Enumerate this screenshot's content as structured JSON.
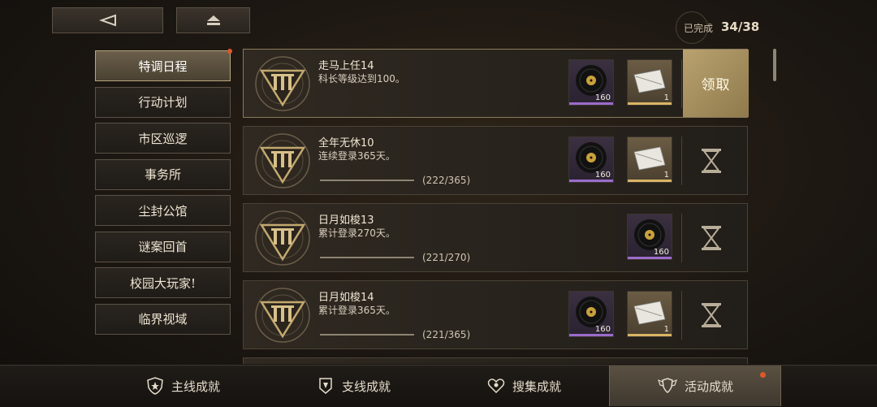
{
  "header": {
    "back_icon": "back-arrow-icon",
    "home_icon": "eject-home-icon",
    "progress_label": "已完成",
    "progress_value": "34/38"
  },
  "sidebar": {
    "items": [
      {
        "label": "特调日程",
        "active": true,
        "has_dot": true
      },
      {
        "label": "行动计划"
      },
      {
        "label": "市区巡逻"
      },
      {
        "label": "事务所"
      },
      {
        "label": "尘封公馆"
      },
      {
        "label": "谜案回首"
      },
      {
        "label": "校园大玩家!"
      },
      {
        "label": "临界视域"
      }
    ]
  },
  "tasks": [
    {
      "title": "走马上任14",
      "desc": "科长等级达到100。",
      "progress": "",
      "rewards": [
        {
          "icon": "vinyl-record-icon",
          "qty": "160"
        },
        {
          "icon": "ticket-envelope-icon",
          "qty": "1"
        }
      ],
      "action": "领取"
    },
    {
      "title": "全年无休10",
      "desc": "连续登录365天。",
      "progress": "(222/365)",
      "rewards": [
        {
          "icon": "vinyl-record-icon",
          "qty": "160"
        },
        {
          "icon": "ticket-envelope-icon",
          "qty": "1"
        }
      ],
      "action": "hourglass-icon"
    },
    {
      "title": "日月如梭13",
      "desc": "累计登录270天。",
      "progress": "(221/270)",
      "rewards": [
        {
          "icon": "vinyl-record-icon",
          "qty": "160"
        }
      ],
      "action": "hourglass-icon"
    },
    {
      "title": "日月如梭14",
      "desc": "累计登录365天。",
      "progress": "(221/365)",
      "rewards": [
        {
          "icon": "vinyl-record-icon",
          "qty": "160"
        },
        {
          "icon": "ticket-envelope-icon",
          "qty": "1"
        }
      ],
      "action": "hourglass-icon"
    }
  ],
  "bottom_tabs": [
    {
      "label": "主线成就",
      "icon": "shield-icon"
    },
    {
      "label": "支线成就",
      "icon": "badge-icon"
    },
    {
      "label": "搜集成就",
      "icon": "heart-crest-icon"
    },
    {
      "label": "活动成就",
      "icon": "winged-shield-icon",
      "active": true,
      "has_dot": true
    }
  ],
  "colors": {
    "accent_gold": "#b9a26f",
    "notify_red": "#e0572a",
    "record_purple": "#9b6ccb"
  }
}
